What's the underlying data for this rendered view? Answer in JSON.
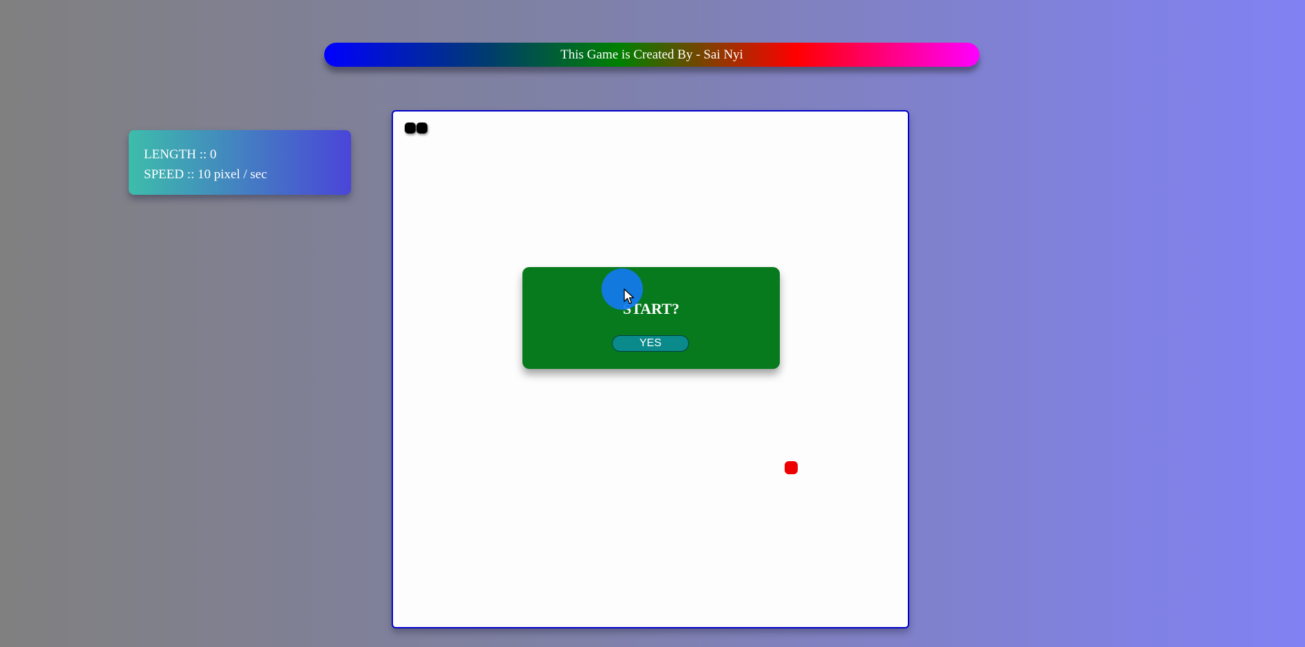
{
  "header": {
    "credit": "This Game is Created By - Sai Nyi"
  },
  "stats": {
    "length_label": "LENGTH :: 0",
    "speed_label": "SPEED :: 10 pixel / sec",
    "length": 0,
    "speed": 10
  },
  "dialog": {
    "title": "START?",
    "button_label": "YES"
  },
  "board": {
    "snake_segments": 2
  },
  "colors": {
    "dialog_bg": "#077a1e",
    "button_bg": "#0a8a8a",
    "food": "#ee0000",
    "snake": "#000000",
    "board_border": "#0000cd"
  },
  "icons": {
    "cursor": "mouse-pointer-icon"
  }
}
